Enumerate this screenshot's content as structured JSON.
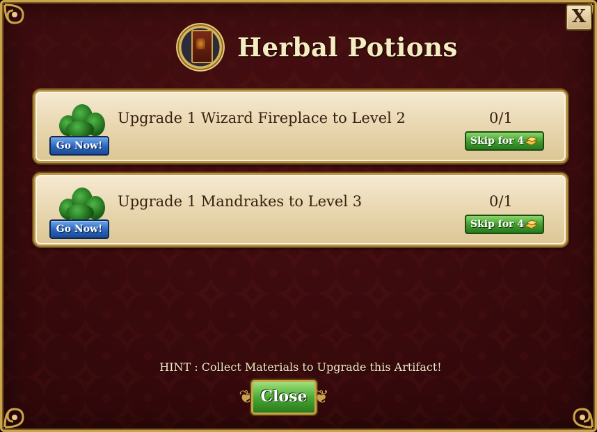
{
  "dialog": {
    "title": "Herbal Potions",
    "close_x_label": "X"
  },
  "tasks": [
    {
      "label": "Upgrade 1 Wizard Fireplace to Level 2",
      "progress": "0/1",
      "go_label": "Go Now!",
      "skip_label": "Skip for 4"
    },
    {
      "label": "Upgrade 1 Mandrakes to Level 3",
      "progress": "0/1",
      "go_label": "Go Now!",
      "skip_label": "Skip for 4"
    }
  ],
  "hint": "HINT : Collect Materials to Upgrade this Artifact!",
  "close_label": "Close",
  "icons": {
    "artifact": "fireplace-cabinet-icon",
    "plant": "mandrake-plant-icon",
    "currency": "gold-bars-icon"
  },
  "colors": {
    "background": "#4a0f12",
    "gold_border": "#c9a44a",
    "go_button": "#2a64bd",
    "skip_button": "#3f9a2c",
    "close_button": "#43a630"
  }
}
